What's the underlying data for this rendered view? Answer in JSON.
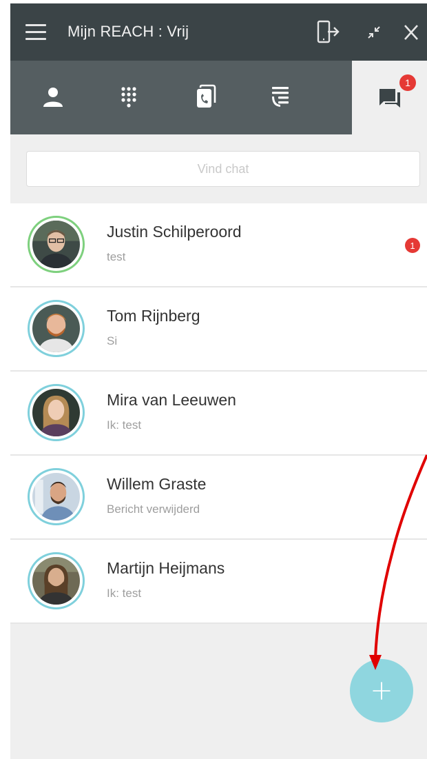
{
  "header": {
    "title": "Mijn REACH : Vrij",
    "icons": [
      "menu-icon",
      "sign-out-icon",
      "minimize-icon",
      "close-icon"
    ]
  },
  "tabs": [
    {
      "name": "contacts",
      "icon": "user-icon"
    },
    {
      "name": "dialpad",
      "icon": "dialpad-icon"
    },
    {
      "name": "calls",
      "icon": "phone-transfer-icon"
    },
    {
      "name": "queues",
      "icon": "call-list-icon"
    },
    {
      "name": "chat",
      "icon": "chat-icon",
      "badge": "1",
      "active": true
    }
  ],
  "search": {
    "placeholder": "Vind chat",
    "value": ""
  },
  "chats": [
    {
      "name": "Justin Schilperoord",
      "preview": "test",
      "badge": "1",
      "status": "online"
    },
    {
      "name": "Tom Rijnberg",
      "preview": "Si",
      "status": "away"
    },
    {
      "name": "Mira van Leeuwen",
      "preview": "Ik: test",
      "status": "away"
    },
    {
      "name": "Willem Graste",
      "preview": "Bericht verwijderd",
      "status": "away"
    },
    {
      "name": "Martijn Heijmans",
      "preview": "Ik: test",
      "status": "away"
    }
  ],
  "fab": {
    "label": "+",
    "icon": "plus-icon"
  },
  "colors": {
    "header_bg": "#3b4447",
    "tabbar_bg": "#555e61",
    "badge": "#e53935",
    "fab": "#8fd6df",
    "online_ring": "#7ed07e",
    "away_ring": "#7fd0dc",
    "annotation_arrow": "#e00000"
  }
}
